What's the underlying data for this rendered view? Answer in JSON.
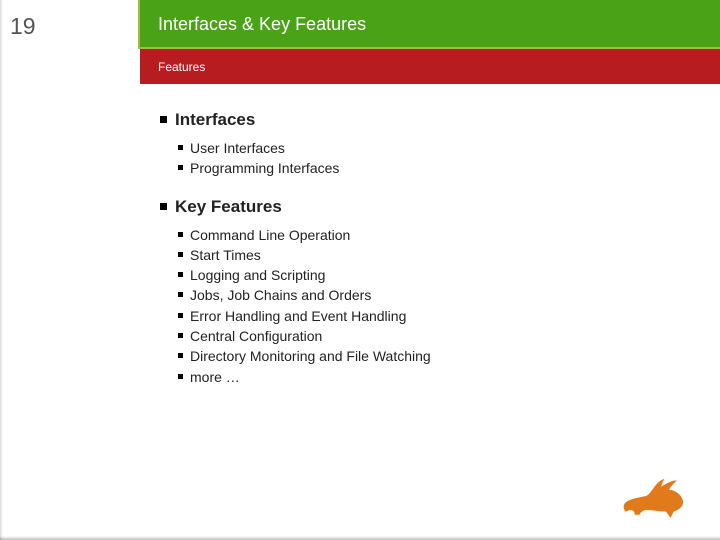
{
  "slide": {
    "number": "19",
    "title": "Interfaces & Key Features",
    "subtitle": "Features"
  },
  "sections": {
    "interfaces": {
      "heading": "Interfaces",
      "items": [
        "User Interfaces",
        "Programming Interfaces"
      ]
    },
    "key_features": {
      "heading": "Key Features",
      "items": [
        "Command Line Operation",
        "Start Times",
        "Logging and Scripting",
        "Jobs, Job Chains and Orders",
        "Error Handling and Event Handling",
        "Central Configuration",
        "Directory Monitoring and File Watching",
        "more …"
      ]
    }
  },
  "logo": {
    "name": "rabbit-logo",
    "color": "#e17a1b"
  },
  "colors": {
    "header_green": "#4aa217",
    "subheader_red": "#b71d20",
    "accent_green": "#a0bf33"
  }
}
